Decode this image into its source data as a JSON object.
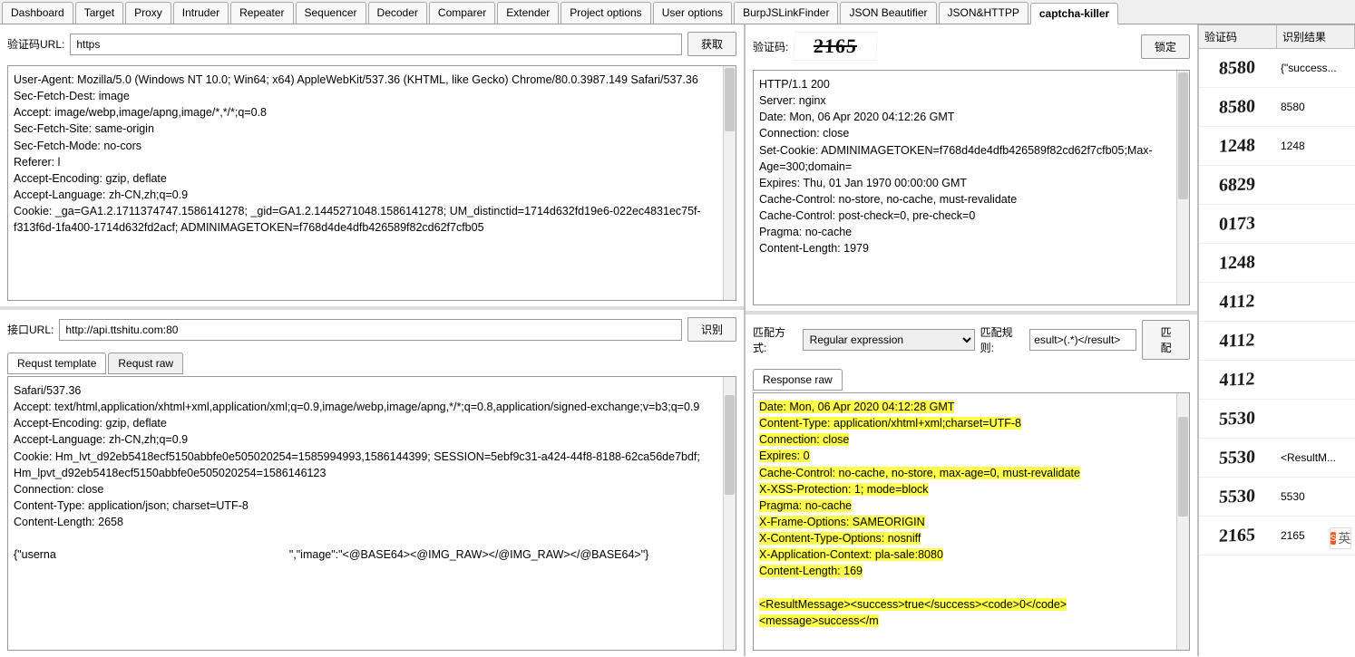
{
  "tabs": [
    "Dashboard",
    "Target",
    "Proxy",
    "Intruder",
    "Repeater",
    "Sequencer",
    "Decoder",
    "Comparer",
    "Extender",
    "Project options",
    "User options",
    "BurpJSLinkFinder",
    "JSON Beautifier",
    "JSON&HTTPP",
    "captcha-killer"
  ],
  "activeTab": 14,
  "left": {
    "captcha_url_label": "验证码URL:",
    "captcha_url_value": "https",
    "fetch_btn": "获取",
    "request_headers": "User-Agent: Mozilla/5.0 (Windows NT 10.0; Win64; x64) AppleWebKit/537.36 (KHTML, like Gecko) Chrome/80.0.3987.149 Safari/537.36\nSec-Fetch-Dest: image\nAccept: image/webp,image/apng,image/*,*/*;q=0.8\nSec-Fetch-Site: same-origin\nSec-Fetch-Mode: no-cors\nReferer: l\nAccept-Encoding: gzip, deflate\nAccept-Language: zh-CN,zh;q=0.9\nCookie: _ga=GA1.2.1711374747.1586141278; _gid=GA1.2.1445271048.1586141278; UM_distinctid=1714d632fd19e6-022ec4831ec75f-f313f6d-1fa400-1714d632fd2acf; ADMINIMAGETOKEN=f768d4de4dfb426589f82cd62f7cfb05",
    "api_url_label": "接口URL:",
    "api_url_value": "http://api.ttshitu.com:80",
    "identify_btn": "识别",
    "req_tabs": [
      "Requst template",
      "Requst raw"
    ],
    "active_req_tab": 0,
    "request_template": "Safari/537.36\nAccept: text/html,application/xhtml+xml,application/xml;q=0.9,image/webp,image/apng,*/*;q=0.8,application/signed-exchange;v=b3;q=0.9\nAccept-Encoding: gzip, deflate\nAccept-Language: zh-CN,zh;q=0.9\nCookie: Hm_lvt_d92eb5418ecf5150abbfe0e505020254=1585994993,1586144399; SESSION=5ebf9c31-a424-44f8-8188-62ca56de7bdf; Hm_lpvt_d92eb5418ecf5150abbfe0e505020254=1586146123\nConnection: close\nContent-Type: application/json; charset=UTF-8\nContent-Length: 2658\n\n{\"userna                                                                          \",\"image\":\"<@BASE64><@IMG_RAW></@IMG_RAW></@BASE64>\"}"
  },
  "mid": {
    "captcha_label": "验证码:",
    "captcha_value": "2165",
    "lock_btn": "锁定",
    "response_raw": "HTTP/1.1 200\nServer: nginx\nDate: Mon, 06 Apr 2020 04:12:26 GMT\nConnection: close\nSet-Cookie: ADMINIMAGETOKEN=f768d4de4dfb426589f82cd62f7cfb05;Max-Age=300;domain=                              \nExpires: Thu, 01 Jan 1970 00:00:00 GMT\nCache-Control: no-store, no-cache, must-revalidate\nCache-Control: post-check=0, pre-check=0\nPragma: no-cache\nContent-Length: 1979",
    "match_mode_label": "匹配方式:",
    "match_mode_value": "Regular expression",
    "match_rule_label": "匹配规则:",
    "match_rule_value": "esult>(.*)</result>",
    "match_btn": "匹配",
    "resp_tab": "Response raw",
    "response_highlighted": [
      "Date: Mon, 06 Apr 2020 04:12:28 GMT",
      "Content-Type: application/xhtml+xml;charset=UTF-8",
      "Connection: close",
      "Expires: 0",
      "Cache-Control: no-cache, no-store, max-age=0, must-revalidate",
      "X-XSS-Protection: 1; mode=block",
      "Pragma: no-cache",
      "X-Frame-Options: SAMEORIGIN",
      "X-Content-Type-Options: nosniff",
      "X-Application-Context: pla-sale:8080",
      "Content-Length: 169",
      "",
      "<ResultMessage><success>true</success><code>0</code><message>success</m"
    ]
  },
  "results": {
    "col1": "验证码",
    "col2": "识别结果",
    "rows": [
      {
        "img": "8580",
        "res": "{\"success..."
      },
      {
        "img": "8580",
        "res": "8580"
      },
      {
        "img": "1248",
        "res": "1248"
      },
      {
        "img": "6829",
        "res": ""
      },
      {
        "img": "0173",
        "res": ""
      },
      {
        "img": "1248",
        "res": ""
      },
      {
        "img": "4112",
        "res": ""
      },
      {
        "img": "4112",
        "res": ""
      },
      {
        "img": "4112",
        "res": ""
      },
      {
        "img": "5530",
        "res": ""
      },
      {
        "img": "5530",
        "res": "<ResultM..."
      },
      {
        "img": "5530",
        "res": "5530"
      },
      {
        "img": "2165",
        "res": "2165"
      }
    ]
  },
  "ime_hint": "英"
}
